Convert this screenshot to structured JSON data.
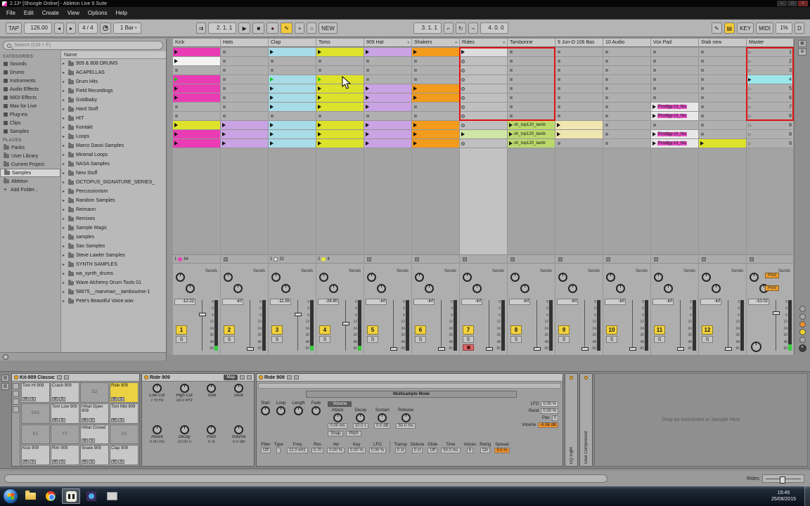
{
  "window": {
    "title": "2.13* [Shoogle Online] - Ableton Live 9 Suite",
    "minimize": "–",
    "maximize": "□",
    "close": "×"
  },
  "icons": {
    "tri_right": "▸",
    "tri_down": "▾",
    "tri_filled": "▶",
    "tri_outline": "▷",
    "grid": "▦",
    "lines": "≣",
    "plus": "+",
    "play": "▶",
    "stop": "■",
    "record": "●",
    "circle": "○",
    "pencil": "✎",
    "kbd": "▤",
    "punch_in": "⌐",
    "punch_out": "¬",
    "loop": "↻",
    "follow": "⇉",
    "nudge_down": "◂",
    "nudge_up": "▸",
    "close": "×"
  },
  "menu": {
    "items": [
      "File",
      "Edit",
      "Create",
      "View",
      "Options",
      "Help"
    ]
  },
  "transport": {
    "tap": "TAP",
    "tempo": "126.00",
    "sig": "4 / 4",
    "quantize": "1 Bar",
    "arr_position": "2. 1. 1",
    "loop_start": "3. 1. 1",
    "loop_length": "4. 0. 0",
    "new_label": "NEW",
    "key_label": "KEY",
    "midi_label": "MIDI",
    "cpu": "1%",
    "disk_overload": "D"
  },
  "browser": {
    "search_placeholder": "Search (Ctrl + F)",
    "categories_title": "CATEGORIES",
    "categories": [
      "Sounds",
      "Drums",
      "Instruments",
      "Audio Effects",
      "MIDI Effects",
      "Max for Live",
      "Plug-ins",
      "Clips",
      "Samples"
    ],
    "places_title": "PLACES",
    "places": [
      "Packs",
      "User Library",
      "Current Project",
      "Samples",
      "Ableton",
      "Add Folder..."
    ],
    "selected_place": "Samples",
    "name_header": "Name",
    "files": [
      "909 & 808 DRUMS",
      "ACAPELLAS",
      "Drum Hits",
      "Field Recordings",
      "Goldbaby",
      "Hard Stuff",
      "HIT",
      "Kontakt",
      "Loops",
      "Marco Dassi Samples",
      "Minimal Loops",
      "NASA Samples",
      "New Stuff",
      "OCTOPUS_SIGNATURE_SERIES_",
      "Percussionism",
      "Random Samples",
      "Reimann",
      "Remixes",
      "Sample Magic",
      "samples",
      "Sax Samples",
      "Steve Lawler Samples",
      "SYNTH SAMPLES",
      "wa_synth_drums",
      "Wave Alchemy Drum Tools 01",
      "58875__marvman__tambourine-1",
      "Pete's Beautiful Voice.wav"
    ]
  },
  "session": {
    "clip_colors": {
      "magenta": "#e93cb4",
      "white": "#f2f2f2",
      "cyan": "#a8dce8",
      "yellow": "#dde22b",
      "lavender": "#c9a3e3",
      "orange": "#f29b1d",
      "pale": "#dcdcdc",
      "palegreen": "#cfe6a5",
      "green": "#bcd96e",
      "cream": "#efe6b0",
      "light": "#e8e8e8"
    },
    "scenes": [
      "1",
      "2",
      "3",
      "4",
      "5",
      "6",
      "7",
      "8",
      "8",
      "8",
      "8"
    ],
    "playing_scene_index": 3,
    "master_name": "Master",
    "sends_label": "Sends",
    "solo_label": "S",
    "scale_labels": [
      "6",
      "0",
      "6",
      "12",
      "24",
      "36",
      "48",
      "60"
    ],
    "master": {
      "volume": "-10.02",
      "post_a": "Post",
      "post_b": "Post"
    },
    "tracks": [
      {
        "name": "Kick",
        "number": "1",
        "volume": "-12.22",
        "clips": [
          {
            "c": "magenta"
          },
          {
            "c": "white"
          },
          null,
          {
            "c": "magenta",
            "playing": true
          },
          {
            "c": "magenta"
          },
          {
            "c": "magenta"
          },
          null,
          null,
          {
            "c": "yellow"
          },
          {
            "c": "magenta"
          },
          {
            "c": "magenta"
          }
        ],
        "status": {
          "bar": "1",
          "dot": "#ee3fb2",
          "len": "64"
        }
      },
      {
        "name": "Hats",
        "number": "2",
        "volume": "-inf",
        "clips": [
          null,
          null,
          null,
          null,
          null,
          null,
          null,
          null,
          {
            "c": "lavender"
          },
          {
            "c": "lavender"
          },
          {
            "c": "lavender"
          }
        ]
      },
      {
        "name": "Clap",
        "number": "3",
        "volume": "-11.55",
        "clips": [
          {
            "c": "cyan"
          },
          null,
          null,
          {
            "c": "cyan",
            "playing": true
          },
          {
            "c": "cyan"
          },
          {
            "c": "cyan"
          },
          {
            "c": "cyan"
          },
          null,
          {
            "c": "cyan"
          },
          {
            "c": "cyan"
          },
          {
            "c": "cyan"
          }
        ],
        "status": {
          "bar": "1",
          "dot": "#f2f2f2",
          "len": "32"
        }
      },
      {
        "name": "Toms",
        "number": "4",
        "volume": "-24.80",
        "clips": [
          {
            "c": "yellow"
          },
          null,
          null,
          {
            "c": "yellow",
            "playing": true
          },
          {
            "c": "yellow"
          },
          {
            "c": "yellow"
          },
          {
            "c": "yellow"
          },
          null,
          {
            "c": "yellow"
          },
          {
            "c": "yellow"
          },
          {
            "c": "yellow"
          }
        ],
        "status": {
          "bar": "2",
          "dot": "#e8e838",
          "len": "4"
        }
      },
      {
        "name": "909 Hat",
        "number": "5",
        "volume": "-inf",
        "fold": true,
        "clips": [
          {
            "c": "lavender"
          },
          null,
          null,
          null,
          {
            "c": "lavender"
          },
          {
            "c": "lavender"
          },
          {
            "c": "lavender"
          },
          null,
          {
            "c": "lavender"
          },
          {
            "c": "lavender"
          },
          {
            "c": "lavender"
          }
        ]
      },
      {
        "name": "Shakers",
        "number": "6",
        "volume": "-inf",
        "fold": true,
        "clips": [
          {
            "c": "orange"
          },
          null,
          null,
          null,
          {
            "c": "orange"
          },
          {
            "c": "orange"
          },
          null,
          null,
          {
            "c": "orange"
          },
          {
            "c": "orange"
          },
          {
            "c": "orange"
          }
        ]
      },
      {
        "name": "Rides",
        "number": "7",
        "volume": "-inf",
        "armed": true,
        "selected": true,
        "fold": true,
        "clips": [
          {
            "c": "pale"
          },
          null,
          null,
          null,
          null,
          null,
          null,
          null,
          null,
          {
            "c": "palegreen"
          },
          null
        ]
      },
      {
        "name": "Tamborine",
        "number": "8",
        "volume": "-inf",
        "clips": [
          null,
          null,
          null,
          null,
          null,
          null,
          null,
          null,
          {
            "c": "green",
            "label": "vh_top120_tamb"
          },
          {
            "c": "green",
            "label": "vh_top120_tamb"
          },
          {
            "c": "green",
            "label": "vh_top120_tamb"
          }
        ]
      },
      {
        "name": "9 Jun-O 106 Bas",
        "number": "9",
        "volume": "-inf",
        "clips": [
          null,
          null,
          null,
          null,
          null,
          null,
          null,
          null,
          {
            "c": "cream"
          },
          {
            "c": "cream"
          },
          null
        ]
      },
      {
        "name": "10 Audio",
        "number": "10",
        "volume": "-inf",
        "clips": [
          null,
          null,
          null,
          null,
          null,
          null,
          null,
          null,
          null,
          null,
          null
        ]
      },
      {
        "name": "Vox Pad",
        "number": "11",
        "volume": "-inf",
        "clips": [
          null,
          null,
          null,
          null,
          null,
          null,
          {
            "c": "light",
            "label": "Prodigy-Ur_No",
            "hl": true
          },
          {
            "c": "light",
            "label": "Prodigy-Ur_No",
            "hl": true
          },
          null,
          {
            "c": "light",
            "label": "Prodigy-Ur_No",
            "hl": true
          },
          {
            "c": "light",
            "label": "Prodigy-Ur_No",
            "hl": true
          }
        ]
      },
      {
        "name": "Stab new",
        "number": "12",
        "volume": "-inf",
        "clips": [
          null,
          null,
          null,
          null,
          null,
          null,
          null,
          null,
          null,
          null,
          {
            "c": "yellow"
          }
        ]
      }
    ]
  },
  "devices": {
    "drum_rack": {
      "title": "Kit-909 Classic",
      "mute_label": "M",
      "solo_label": "S",
      "pads": [
        {
          "n": "Tom Hi 909",
          "filled": true
        },
        {
          "n": "Crash 909",
          "filled": true
        },
        {
          "n": "D2",
          "filled": false
        },
        {
          "n": "Ride 909",
          "filled": true,
          "selected": true
        },
        {
          "n": "G#1",
          "filled": false
        },
        {
          "n": "Tom Low 909",
          "filled": true
        },
        {
          "n": "Hihat Open 909",
          "filled": true
        },
        {
          "n": "Tom Mid 909",
          "filled": true
        },
        {
          "n": "E1",
          "filled": false
        },
        {
          "n": "F1",
          "filled": false
        },
        {
          "n": "Hihat Closed",
          "filled": true
        },
        {
          "n": "G1",
          "filled": false
        },
        {
          "n": "Kick 909",
          "filled": true
        },
        {
          "n": "Rim 909",
          "filled": true
        },
        {
          "n": "Snare 909",
          "filled": true
        },
        {
          "n": "Clap 909",
          "filled": true
        }
      ]
    },
    "macro_rack": {
      "title": "Ride 909",
      "map_label": "Map",
      "macros": [
        {
          "l": "Low Cut",
          "v": "779 Hz"
        },
        {
          "l": "High Cut",
          "v": "18.0 kHz"
        },
        {
          "l": "Tone",
          "v": ""
        },
        {
          "l": "Glue",
          "v": ""
        },
        {
          "l": "Attack",
          "v": "0.00 ms"
        },
        {
          "l": "Decay",
          "v": "10.00 s"
        },
        {
          "l": "Pitch",
          "v": "0 st"
        },
        {
          "l": "Volume",
          "v": "0.0 dB"
        }
      ]
    },
    "sampler": {
      "title": "Ride 909",
      "mode": "Multisample Mode",
      "sample_knobs": [
        "Start",
        "Loop",
        "Length",
        "Fade"
      ],
      "env_title": "Volume",
      "env_params": [
        {
          "l": "Attack",
          "v": "0.00 ms"
        },
        {
          "l": "Decay",
          "v": "10.0 s"
        },
        {
          "l": "Sustain",
          "v": "0.0 dB"
        },
        {
          "l": "Release",
          "v": "50.0 ms"
        }
      ],
      "toggles": [
        "Snap",
        "Pitch"
      ],
      "side_params": [
        {
          "l": "LFO",
          "v": "0.00 %"
        },
        {
          "l": "Rand",
          "v": "0.00 %"
        },
        {
          "l": "Pan",
          "v": "0"
        },
        {
          "l": "Volume",
          "v": "-6.56 dB",
          "accent": true
        }
      ],
      "filter_row": [
        {
          "l": "Filter",
          "v": "Off"
        },
        {
          "l": "Type",
          "v": ""
        },
        {
          "l": "Freq",
          "v": "22.0 kHz"
        },
        {
          "l": "Res",
          "v": "0.70"
        },
        {
          "l": "Vel",
          "v": "0.00 %"
        },
        {
          "l": "Key",
          "v": "0.00 %"
        },
        {
          "l": "LFO",
          "v": "0.00 %"
        }
      ],
      "global_row": [
        {
          "l": "Transp",
          "v": "0 st"
        },
        {
          "l": "Detune",
          "v": "0 ct"
        },
        {
          "l": "Glide",
          "v": "Off"
        },
        {
          "l": "Time",
          "v": "50.0 ms"
        },
        {
          "l": "Voices",
          "v": "6"
        },
        {
          "l": "Retrig",
          "v": "On"
        },
        {
          "l": "Spread",
          "v": "3.5 %",
          "accent": true
        }
      ]
    },
    "collapsed": [
      "EQ Eight",
      "Glue Compressor"
    ],
    "drop_hint": "Drop an Instrument or Sample Here"
  },
  "status_bar": {
    "selected_label": "Rides"
  },
  "taskbar": {
    "time": "15:45",
    "date": "25/08/2015",
    "apps": [
      "explorer",
      "chrome",
      "ableton-live",
      "media-player",
      "notepad"
    ],
    "active_app": "ableton-live"
  }
}
